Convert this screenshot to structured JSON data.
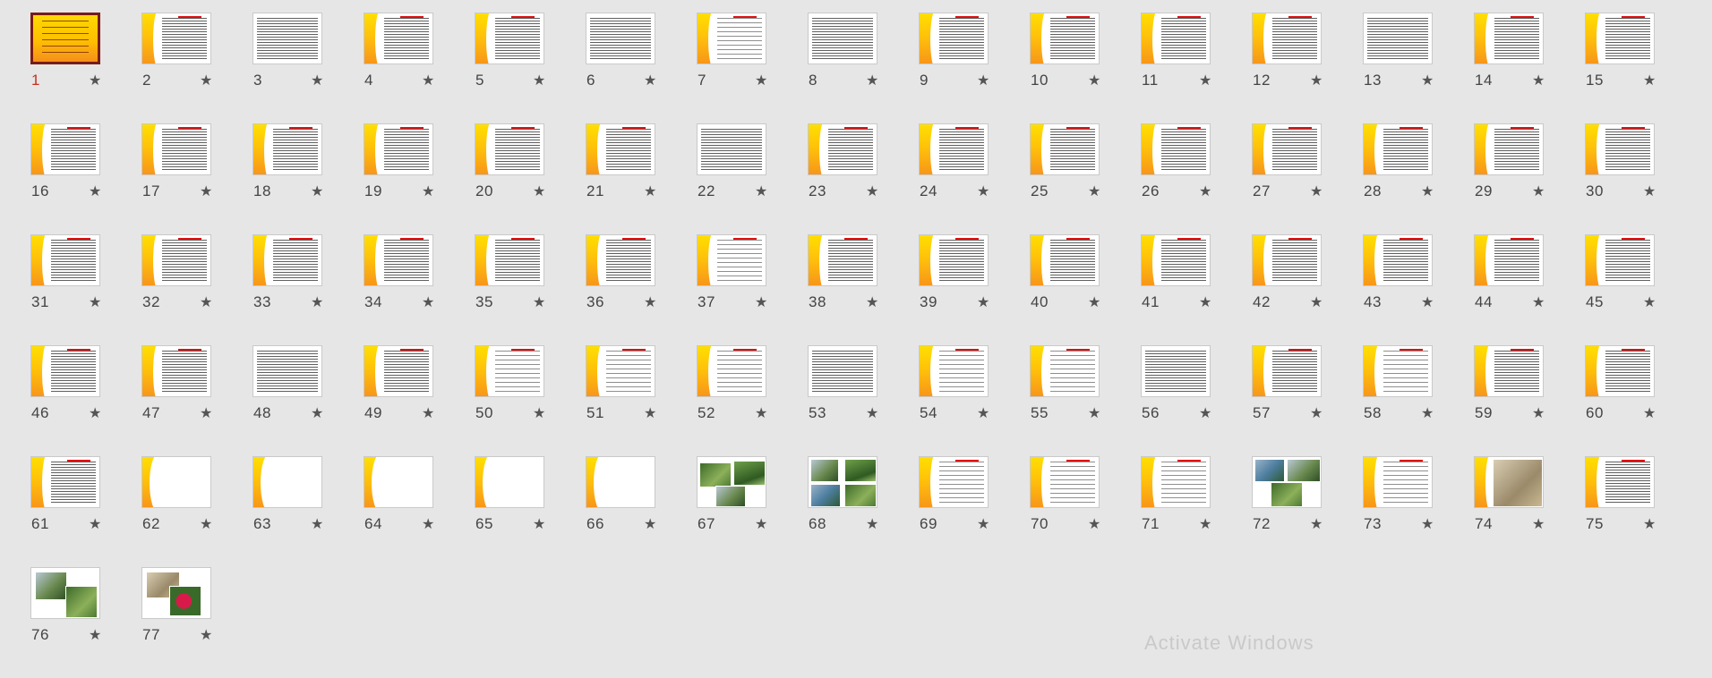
{
  "slides": [
    {
      "num": "1",
      "kind": "title",
      "selected": true
    },
    {
      "num": "2",
      "kind": "text"
    },
    {
      "num": "3",
      "kind": "full"
    },
    {
      "num": "4",
      "kind": "text"
    },
    {
      "num": "5",
      "kind": "text"
    },
    {
      "num": "6",
      "kind": "full"
    },
    {
      "num": "7",
      "kind": "sparse"
    },
    {
      "num": "8",
      "kind": "full"
    },
    {
      "num": "9",
      "kind": "text"
    },
    {
      "num": "10",
      "kind": "text"
    },
    {
      "num": "11",
      "kind": "text"
    },
    {
      "num": "12",
      "kind": "text"
    },
    {
      "num": "13",
      "kind": "full"
    },
    {
      "num": "14",
      "kind": "text"
    },
    {
      "num": "15",
      "kind": "text"
    },
    {
      "num": "16",
      "kind": "text"
    },
    {
      "num": "17",
      "kind": "text"
    },
    {
      "num": "18",
      "kind": "text"
    },
    {
      "num": "19",
      "kind": "text"
    },
    {
      "num": "20",
      "kind": "text"
    },
    {
      "num": "21",
      "kind": "text"
    },
    {
      "num": "22",
      "kind": "full"
    },
    {
      "num": "23",
      "kind": "text"
    },
    {
      "num": "24",
      "kind": "text"
    },
    {
      "num": "25",
      "kind": "text"
    },
    {
      "num": "26",
      "kind": "text"
    },
    {
      "num": "27",
      "kind": "text"
    },
    {
      "num": "28",
      "kind": "text"
    },
    {
      "num": "29",
      "kind": "text"
    },
    {
      "num": "30",
      "kind": "text"
    },
    {
      "num": "31",
      "kind": "text"
    },
    {
      "num": "32",
      "kind": "text"
    },
    {
      "num": "33",
      "kind": "text"
    },
    {
      "num": "34",
      "kind": "text"
    },
    {
      "num": "35",
      "kind": "text"
    },
    {
      "num": "36",
      "kind": "text"
    },
    {
      "num": "37",
      "kind": "sparse"
    },
    {
      "num": "38",
      "kind": "text"
    },
    {
      "num": "39",
      "kind": "text"
    },
    {
      "num": "40",
      "kind": "text"
    },
    {
      "num": "41",
      "kind": "text"
    },
    {
      "num": "42",
      "kind": "text"
    },
    {
      "num": "43",
      "kind": "text"
    },
    {
      "num": "44",
      "kind": "text"
    },
    {
      "num": "45",
      "kind": "text"
    },
    {
      "num": "46",
      "kind": "text"
    },
    {
      "num": "47",
      "kind": "text"
    },
    {
      "num": "48",
      "kind": "full"
    },
    {
      "num": "49",
      "kind": "text"
    },
    {
      "num": "50",
      "kind": "sparse"
    },
    {
      "num": "51",
      "kind": "sparse"
    },
    {
      "num": "52",
      "kind": "sparse"
    },
    {
      "num": "53",
      "kind": "full"
    },
    {
      "num": "54",
      "kind": "sparse"
    },
    {
      "num": "55",
      "kind": "sparse"
    },
    {
      "num": "56",
      "kind": "full"
    },
    {
      "num": "57",
      "kind": "text"
    },
    {
      "num": "58",
      "kind": "sparse"
    },
    {
      "num": "59",
      "kind": "text"
    },
    {
      "num": "60",
      "kind": "text"
    },
    {
      "num": "61",
      "kind": "text"
    },
    {
      "num": "62",
      "kind": "blank"
    },
    {
      "num": "63",
      "kind": "blank"
    },
    {
      "num": "64",
      "kind": "blank"
    },
    {
      "num": "65",
      "kind": "blank"
    },
    {
      "num": "66",
      "kind": "blank"
    },
    {
      "num": "67",
      "kind": "photo2"
    },
    {
      "num": "68",
      "kind": "photo4"
    },
    {
      "num": "69",
      "kind": "sparse"
    },
    {
      "num": "70",
      "kind": "sparse"
    },
    {
      "num": "71",
      "kind": "sparse"
    },
    {
      "num": "72",
      "kind": "photo3"
    },
    {
      "num": "73",
      "kind": "sparse"
    },
    {
      "num": "74",
      "kind": "photo1"
    },
    {
      "num": "75",
      "kind": "text"
    },
    {
      "num": "76",
      "kind": "photo2b"
    },
    {
      "num": "77",
      "kind": "photo2c"
    }
  ],
  "star_glyph": "★",
  "watermark": "Activate Windows",
  "colors": {
    "selected_number": "#c8301f",
    "selected_border": "#7a1c14",
    "accent_yellow": "#ffd900",
    "accent_orange": "#f7961a"
  }
}
